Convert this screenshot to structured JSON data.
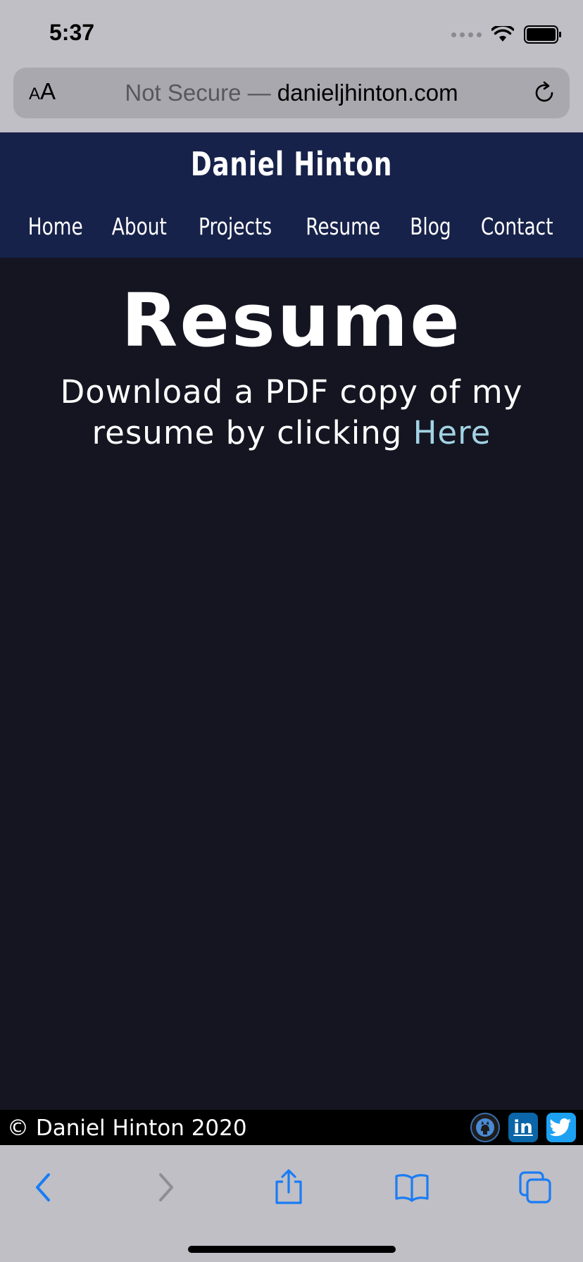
{
  "status_bar": {
    "time": "5:37"
  },
  "browser": {
    "text_size_label_small": "A",
    "text_size_label_large": "A",
    "url_prefix": "Not Secure — ",
    "url_domain": "danieljhinton.com"
  },
  "site": {
    "title": "Daniel Hinton",
    "nav": [
      "Home",
      "About",
      "Projects",
      "Resume",
      "Blog",
      "Contact"
    ]
  },
  "main": {
    "heading": "Resume",
    "intro": "Download a PDF copy of my resume by clicking ",
    "link_label": "Here",
    "link_color": "#a2d3e3"
  },
  "footer": {
    "copyright": "© Daniel Hinton 2020",
    "social": [
      "github-icon",
      "linkedin-icon",
      "twitter-icon"
    ],
    "linkedin_text": "in"
  },
  "colors": {
    "header_bg": "#17224a",
    "content_bg": "#151522",
    "footer_bg": "#000000",
    "ios_accent": "#1a7cf5"
  }
}
